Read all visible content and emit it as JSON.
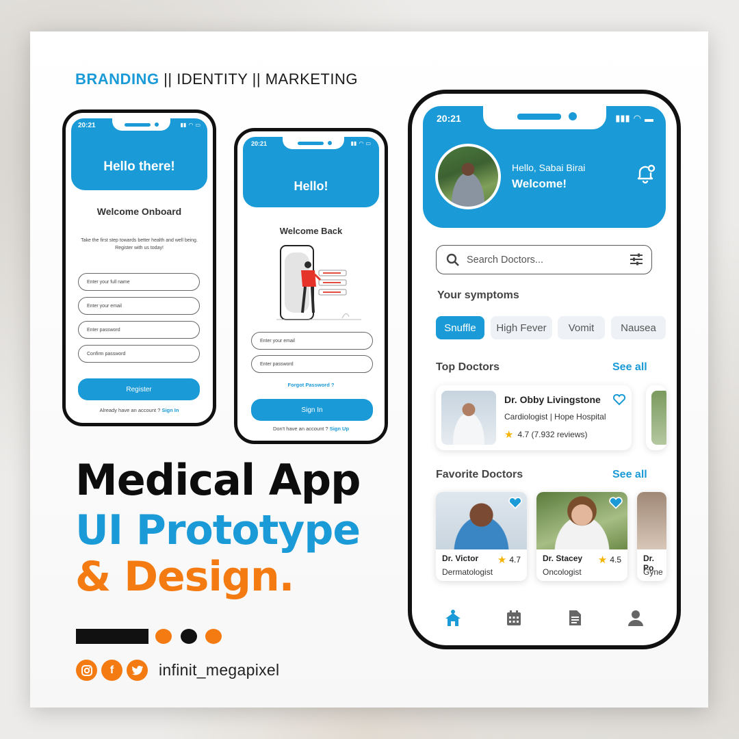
{
  "tagline": {
    "brand": "BRANDING",
    "rest": " || IDENTITY || MARKETING"
  },
  "register_screen": {
    "time": "20:21",
    "hero": "Hello there!",
    "subtitle": "Welcome Onboard",
    "description": "Take the first step towards better health and well being. Register with us today!",
    "fields": [
      "Enter your full name",
      "Enter your email",
      "Enter password",
      "Confirm password"
    ],
    "button": "Register",
    "footer_text": "Already have an account ? ",
    "footer_link": "Sign In"
  },
  "signin_screen": {
    "time": "20:21",
    "hero": "Hello!",
    "subtitle": "Welcome Back",
    "fields": [
      "Enter your email",
      "Enter password"
    ],
    "forgot": "Forgot Password ?",
    "button": "Sign In",
    "footer_text": "Don't have an account ? ",
    "footer_link": "Sign Up"
  },
  "headline": {
    "line1": "Medical App",
    "line2": "UI Prototype",
    "line3": "& Design."
  },
  "social": {
    "handle": "infinit_megapixel",
    "icons": [
      "instagram-icon",
      "facebook-icon",
      "twitter-icon"
    ]
  },
  "home_screen": {
    "time": "20:21",
    "greeting": "Hello, Sabai Birai",
    "welcome": "Welcome!",
    "search_placeholder": "Search Doctors...",
    "symptoms_title": "Your symptoms",
    "symptoms": [
      "Snuffle",
      "High Fever",
      "Vomit",
      "Nausea"
    ],
    "top_doctors_title": "Top Doctors",
    "see_all": "See all",
    "top_doctor": {
      "name": "Dr. Obby Livingstone",
      "specialty": "Cardiologist | Hope Hospital",
      "rating": "4.7 (7.932 reviews)"
    },
    "favorite_title": "Favorite Doctors",
    "favorites": [
      {
        "name": "Dr. Victor",
        "specialty": "Dermatologist",
        "rating": "4.7"
      },
      {
        "name": "Dr. Stacey",
        "specialty": "Oncologist",
        "rating": "4.5"
      },
      {
        "name": "Dr. Po",
        "specialty": "Gyne"
      }
    ],
    "tabs": [
      "home-icon",
      "calendar-icon",
      "document-icon",
      "profile-icon"
    ]
  },
  "colors": {
    "primary": "#1a9ad6",
    "accent": "#f47a12",
    "dark": "#0d0d0d"
  }
}
